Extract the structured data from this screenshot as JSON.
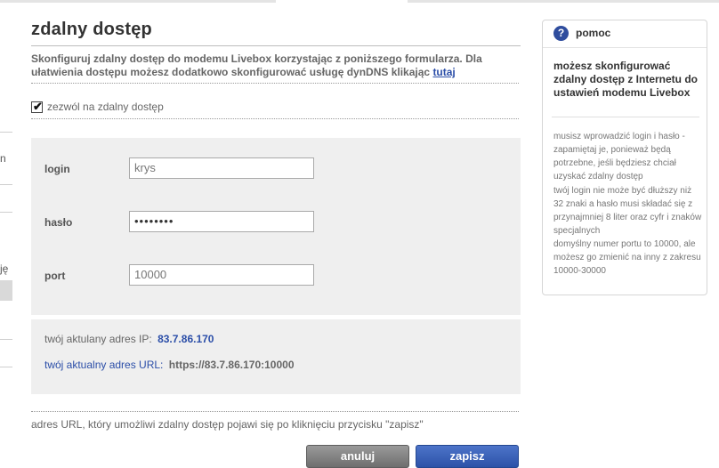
{
  "page": {
    "title": "zdalny dostęp",
    "intro_text": "Skonfiguruj zdalny dostęp do modemu Livebox korzystając z poniższego formularza. Dla ułatwienia dostępu możesz dodatkowo skonfigurować usługę dynDNS klikając",
    "intro_link": "tutaj"
  },
  "sidebar": {
    "fragment_1": "n",
    "fragment_2": "ję"
  },
  "remote_access": {
    "checkbox_label": "zezwól na zdalny dostęp",
    "checked": true
  },
  "form": {
    "login_label": "login",
    "login_value": "krys",
    "password_label": "hasło",
    "password_value": "••••••••",
    "port_label": "port",
    "port_value": "10000"
  },
  "info": {
    "ip_label": "twój aktulany adres IP:",
    "ip_value": "83.7.86.170",
    "url_label": "twój aktualny adres URL:",
    "url_value": "https://83.7.86.170:10000"
  },
  "note": "adres URL, który umożliwi zdalny dostęp pojawi się po kliknięciu przycisku \"zapisz\"",
  "buttons": {
    "cancel": "anuluj",
    "save": "zapisz"
  },
  "help": {
    "icon": "?",
    "title": "pomoc",
    "headline": "możesz skonfigurować zdalny dostęp z Internetu do ustawień modemu Livebox",
    "p1": "musisz wprowadzić login i hasło -zapamiętaj je, ponieważ będą potrzebne, jeśli będziesz chciał uzyskać zdalny dostęp",
    "p2": "twój login nie może być dłuższy niż 32 znaki a hasło musi składać się z przynajmniej 8 liter oraz cyfr i znaków specjalnych",
    "p3": "domyślny numer portu to 10000, ale możesz go zmienić na inny z zakresu 10000-30000"
  },
  "colors": {
    "accent_blue": "#2b4ea8",
    "save_button": "#2c52a8",
    "cancel_button": "#6e6e6e",
    "panel_bg": "#efefef"
  }
}
